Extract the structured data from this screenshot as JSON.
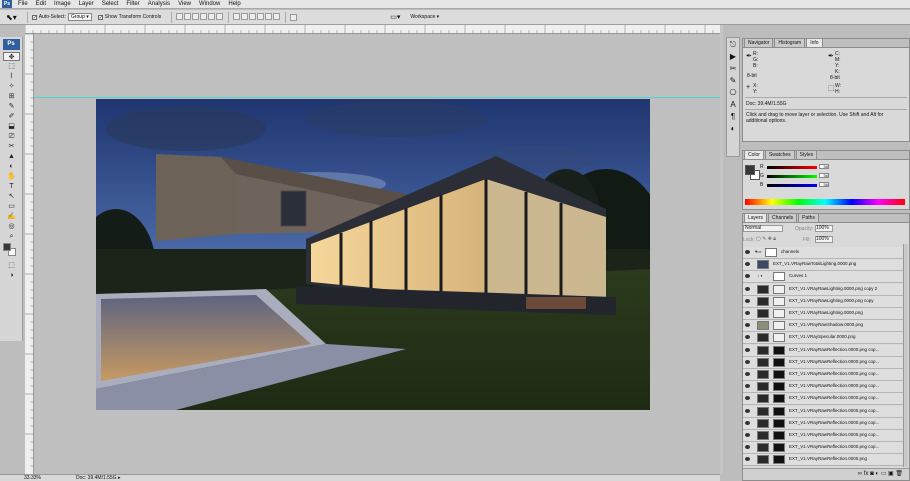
{
  "menubar": {
    "logo": "Ps",
    "items": [
      "File",
      "Edit",
      "Image",
      "Layer",
      "Select",
      "Filter",
      "Analysis",
      "View",
      "Window",
      "Help"
    ]
  },
  "options": {
    "auto_select_label": "Auto-Select:",
    "auto_select_value": "Group",
    "transform_label": "Show Transform Controls",
    "workspace_label": "Workspace ▾"
  },
  "toolbox": {
    "ps_label": "Ps",
    "tools": [
      "✥",
      "⬚",
      "⌇",
      "✧",
      "⊞",
      "✎",
      "✐",
      "⬓",
      "⎚",
      "✂",
      "▲",
      "◐",
      "✋",
      "T",
      "↖",
      "▭",
      "✍",
      "◎",
      "⌕",
      "⬚",
      "◑"
    ]
  },
  "status": {
    "zoom": "33.33%",
    "doc": "Doc: 39.4M/1.55G"
  },
  "info_panel": {
    "tabs": [
      "Navigator",
      "Histogram",
      "Info"
    ],
    "active_tab": "Info",
    "r_label": "R:",
    "g_label": "G:",
    "b_label": "B:",
    "c_label": "C:",
    "m_label": "M:",
    "y_label": "Y:",
    "k_label": "K:",
    "bits_left": "8-bit",
    "bits_right": "8-bit",
    "x_label": "X:",
    "y2_label": "Y:",
    "w_label": "W:",
    "h_label": "H:",
    "doc": "Doc: 39.4M/1.55G",
    "hint": "Click and drag to move layer or selection. Use Shift and Alt for additional options."
  },
  "color_panel": {
    "tabs": [
      "Color",
      "Swatches",
      "Styles"
    ],
    "active_tab": "Color",
    "r": "R",
    "g": "G",
    "b": "B",
    "r_value": "56",
    "g_value": "56",
    "b_value": "56"
  },
  "layers_panel": {
    "tabs": [
      "Layers",
      "Channels",
      "Paths"
    ],
    "active_tab": "Layers",
    "blend_mode": "Normal",
    "opacity_label": "Opacity:",
    "opacity_value": "100%",
    "lock_label": "Lock:",
    "fill_label": "Fill:",
    "fill_value": "100%",
    "layers": [
      "channels",
      "EXT_V1.VRayRawTotalLighting.0000.png",
      "Curves 1",
      "EXT_V1.VRayRawLighting.0000.png copy 2",
      "EXT_V1.VRayRawLighting.0000.png copy",
      "EXT_V1.VRayRawLighting.0000.png",
      "EXT_V1.VRayRawShadow.0000.png",
      "EXT_V1.VRaySpecular.0000.png",
      "EXT_V1.VRayRawReflection.0000.png cop...",
      "EXT_V1.VRayRawReflection.0000.png cop...",
      "EXT_V1.VRayRawReflection.0000.png cop...",
      "EXT_V1.VRayRawReflection.0000.png cop...",
      "EXT_V1.VRayRawReflection.0000.png cop...",
      "EXT_V1.VRayRawReflection.0000.png cop...",
      "EXT_V1.VRayRawReflection.0000.png cop...",
      "EXT_V1.VRayRawReflection.0000.png cop...",
      "EXT_V1.VRayRawReflection.0000.png cop...",
      "EXT_V1.VRayRawReflection.0000.png"
    ]
  },
  "colors": {
    "foreground": "#383838",
    "background": "#ffffff",
    "guide": "#4fd1d1"
  }
}
